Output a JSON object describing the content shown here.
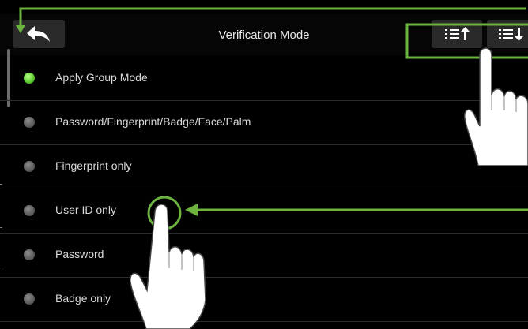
{
  "header": {
    "title": "Verification Mode",
    "back_icon": "back-arrow-icon",
    "sort_up_icon": "list-sort-up-icon",
    "sort_down_icon": "list-sort-down-icon"
  },
  "options": [
    {
      "label": "Apply Group Mode",
      "selected": true
    },
    {
      "label": "Password/Fingerprint/Badge/Face/Palm",
      "selected": false
    },
    {
      "label": "Fingerprint only",
      "selected": false
    },
    {
      "label": "User ID only",
      "selected": false
    },
    {
      "label": "Password",
      "selected": false
    },
    {
      "label": "Badge only",
      "selected": false
    }
  ],
  "colors": {
    "annotation": "#6db33f",
    "background": "#000000",
    "selected_radio": "#5fcf34"
  }
}
